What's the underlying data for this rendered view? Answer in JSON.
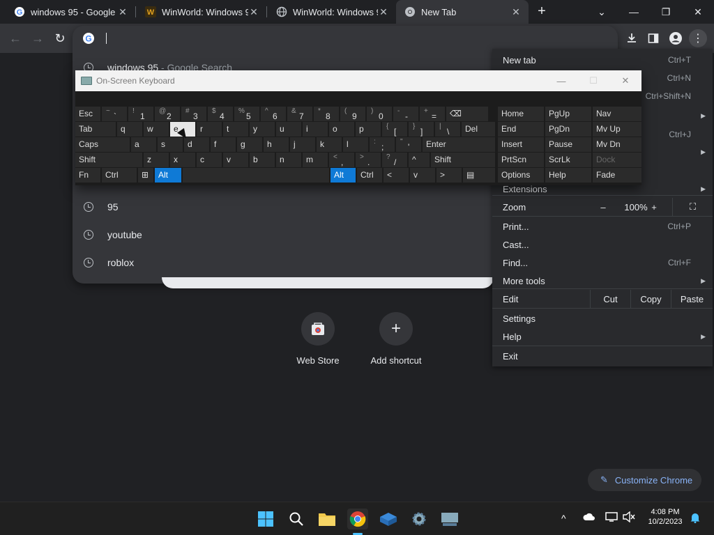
{
  "tabs": [
    {
      "title": "windows 95 - Google S",
      "icon": "google-icon"
    },
    {
      "title": "WinWorld: Windows 9",
      "icon": "winworld-icon"
    },
    {
      "title": "WinWorld: Windows 9",
      "icon": "globe-icon"
    },
    {
      "title": "New Tab",
      "icon": "chrome-icon"
    }
  ],
  "omnibox": {
    "first_suggestion_main": "windows 95",
    "first_suggestion_sep": " - ",
    "first_suggestion_dim": "Google Search",
    "suggestions": [
      "95",
      "youtube",
      "roblox"
    ]
  },
  "shortcuts": [
    {
      "label": "Web Store",
      "icon": "web-store-icon"
    },
    {
      "label": "Add shortcut",
      "icon": "plus-icon"
    }
  ],
  "customize": {
    "label": "Customize Chrome"
  },
  "menu": {
    "new_tab": {
      "label": "New tab",
      "shortcut": "Ctrl+T"
    },
    "new_window_shortcut": "Ctrl+N",
    "incognito_shortcut": "Ctrl+Shift+N",
    "history_shortcut": "Ctrl+J",
    "extensions": "Extensions",
    "zoom": {
      "label": "Zoom",
      "minus": "–",
      "value": "100%",
      "plus": "+"
    },
    "print": {
      "label": "Print...",
      "shortcut": "Ctrl+P"
    },
    "cast": "Cast...",
    "find": {
      "label": "Find...",
      "shortcut": "Ctrl+F"
    },
    "more_tools": "More tools",
    "edit": {
      "label": "Edit",
      "cut": "Cut",
      "copy": "Copy",
      "paste": "Paste"
    },
    "settings": "Settings",
    "help": "Help",
    "exit": "Exit"
  },
  "osk": {
    "title": "On-Screen Keyboard",
    "row1": [
      {
        "main": "Esc"
      },
      {
        "up": "~",
        "dn": "`"
      },
      {
        "up": "!",
        "dn": "1"
      },
      {
        "up": "@",
        "dn": "2"
      },
      {
        "up": "#",
        "dn": "3"
      },
      {
        "up": "$",
        "dn": "4"
      },
      {
        "up": "%",
        "dn": "5"
      },
      {
        "up": "^",
        "dn": "6"
      },
      {
        "up": "&",
        "dn": "7"
      },
      {
        "up": "*",
        "dn": "8"
      },
      {
        "up": "(",
        "dn": "9"
      },
      {
        "up": ")",
        "dn": "0"
      },
      {
        "up": "-",
        "dn": "-"
      },
      {
        "up": "+",
        "dn": "="
      },
      {
        "main": "⌫"
      }
    ],
    "row2": [
      "Tab",
      "q",
      "w",
      "e",
      "r",
      "t",
      "y",
      "u",
      "i",
      "o",
      "p"
    ],
    "row2_sym": [
      {
        "up": "{",
        "dn": "["
      },
      {
        "up": "}",
        "dn": "]"
      },
      {
        "up": "|",
        "dn": "\\"
      }
    ],
    "row2_del": "Del",
    "row3": [
      "Caps",
      "a",
      "s",
      "d",
      "f",
      "g",
      "h",
      "j",
      "k",
      "l"
    ],
    "row3_sym": [
      {
        "up": ":",
        "dn": ";"
      },
      {
        "up": "\"",
        "dn": "'"
      }
    ],
    "row3_enter": "Enter",
    "row4": [
      "Shift",
      "z",
      "x",
      "c",
      "v",
      "b",
      "n",
      "m"
    ],
    "row4_sym": [
      {
        "up": "<",
        "dn": ","
      },
      {
        "up": ">",
        "dn": "."
      },
      {
        "up": "?",
        "dn": "/"
      }
    ],
    "row4_up": "^",
    "row4_shift": "Shift",
    "row5": {
      "fn": "Fn",
      "ctrl": "Ctrl",
      "alt": "Alt",
      "alt2": "Alt",
      "ctrl2": "Ctrl",
      "left": "<",
      "down": "v",
      "right": ">"
    },
    "nav_keys": [
      [
        "Home",
        "PgUp",
        "Nav"
      ],
      [
        "End",
        "PgDn",
        "Mv Up"
      ],
      [
        "Insert",
        "Pause",
        "Mv Dn"
      ],
      [
        "PrtScn",
        "ScrLk",
        "Dock"
      ],
      [
        "Options",
        "Help",
        "Fade"
      ]
    ]
  },
  "taskbar": {
    "apps": [
      "windows-start-icon",
      "search-icon",
      "file-explorer-icon",
      "chrome-icon",
      "app-icon",
      "settings-icon",
      "osk-icon"
    ],
    "time": "4:08 PM",
    "date": "10/2/2023"
  },
  "colors": {
    "accent": "#0f7ad6",
    "link": "#8ab4f8",
    "bg": "#202124"
  }
}
